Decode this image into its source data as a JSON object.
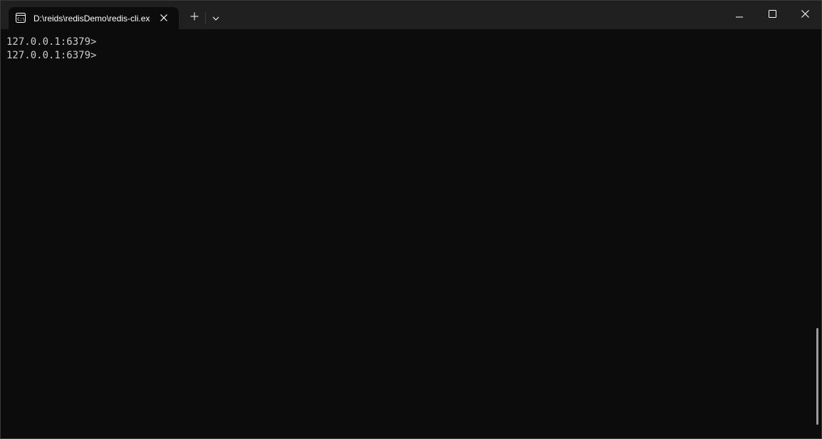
{
  "window": {
    "tab_title": "D:\\reids\\redisDemo\\redis-cli.exe",
    "icons": {
      "tab": "terminal-icon",
      "close_tab": "close-icon",
      "new_tab": "plus-icon",
      "dropdown": "chevron-down-icon",
      "minimize": "minimize-icon",
      "maximize": "maximize-icon",
      "close_window": "close-icon"
    }
  },
  "terminal": {
    "lines": [
      "127.0.0.1:6379>",
      "127.0.0.1:6379>"
    ]
  },
  "colors": {
    "background": "#0c0c0c",
    "titlebar": "#202020",
    "text": "#cccccc"
  }
}
